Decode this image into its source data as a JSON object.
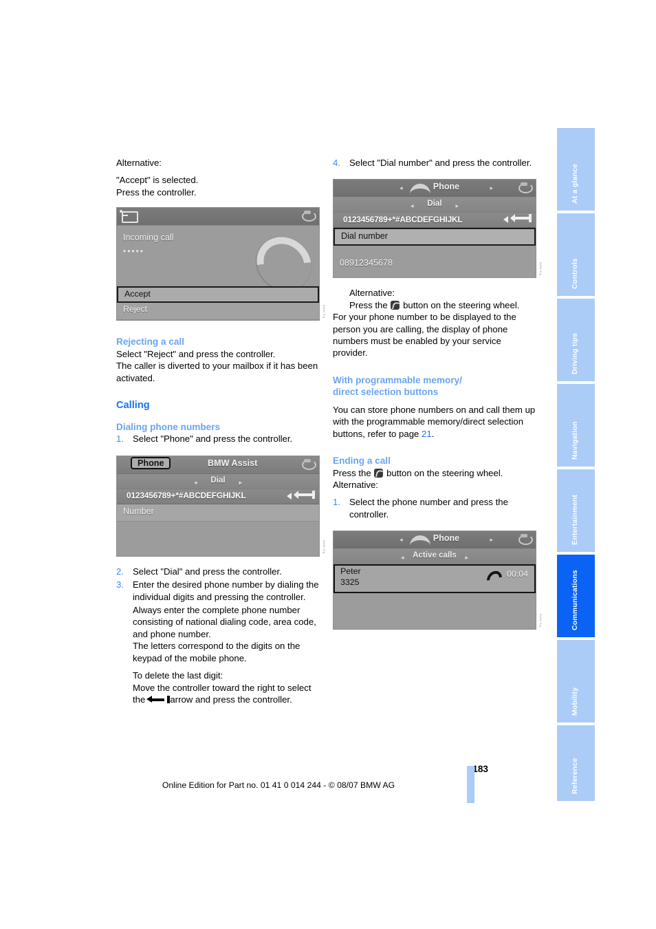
{
  "page": {
    "number": "183",
    "imprint": "Online Edition for Part no. 01 41 0 014 244 - © 08/07 BMW AG"
  },
  "sidebar": {
    "tabs": [
      {
        "label": "At a glance",
        "active": false
      },
      {
        "label": "Controls",
        "active": false
      },
      {
        "label": "Driving tips",
        "active": false
      },
      {
        "label": "Navigation",
        "active": false
      },
      {
        "label": "Entertainment",
        "active": false
      },
      {
        "label": "Communications",
        "active": true
      },
      {
        "label": "Mobility",
        "active": false
      },
      {
        "label": "Reference",
        "active": false
      }
    ],
    "active_color": "#0b63f6",
    "inactive_color": "#aaccf7"
  },
  "left_column": {
    "alt_label": "Alternative:",
    "accept_selected": "\"Accept\" is selected.",
    "press_controller": "Press the controller.",
    "shot_incoming": {
      "header_text": "Incoming call",
      "dots": "•••••",
      "accept": "Accept",
      "reject": "Reject"
    },
    "heading_rejecting": "Rejecting a call",
    "reject_body_1": "Select \"Reject\" and press the controller.",
    "reject_body_2": "The caller is diverted to your mailbox if it has been activated.",
    "heading_calling": "Calling",
    "heading_dialing": "Dialing phone numbers",
    "step1_num": "1.",
    "step1_text": "Select \"Phone\" and press the controller.",
    "shot_dial": {
      "tab_phone": "Phone",
      "tab_bmw_assist": "BMW Assist",
      "subtitle": "Dial",
      "charset": "0123456789+*#ABCDEFGHIJKL",
      "field_label": "Number"
    },
    "step2_num": "2.",
    "step2_text": "Select \"Dial\" and press the controller.",
    "step3_num": "3.",
    "step3_text": "Enter the desired phone number by dialing the individual digits and pressing the controller.",
    "step3_text_b": "Always enter the complete phone number consisting of national dialing code, area code, and phone number.",
    "step3_text_c": "The letters correspond to the digits on the keypad of the mobile phone.",
    "delete_title": "To delete the last digit:",
    "delete_body_pre": "Move the controller toward the right to select the",
    "delete_body_post": "arrow and press the controller."
  },
  "right_column": {
    "step4_num": "4.",
    "step4_text": "Select \"Dial number\" and press the controller.",
    "shot_dialnumber": {
      "title": "Phone",
      "subtitle": "Dial",
      "charset": "0123456789+*#ABCDEFGHIJKL",
      "selected_field": "Dial number",
      "number": "08912345678"
    },
    "alt_label": "Alternative:",
    "alt_press_pre": "Press the",
    "alt_press_post": "button on the steering wheel.",
    "display_note": "For your phone number to be displayed to the person you are calling, the display of phone numbers must be enabled by your service provider.",
    "heading_memory_line1": "With programmable memory/",
    "heading_memory_line2": "direct selection buttons",
    "memory_body_pre": "You can store phone numbers on and call them up with the programmable memory/direct selection buttons, refer to page",
    "memory_page_ref": "21",
    "memory_body_post": ".",
    "heading_ending": "Ending a call",
    "ending_press_pre": "Press the",
    "ending_press_post": "button on the steering wheel.",
    "ending_alt_label": "Alternative:",
    "ending_step1_num": "1.",
    "ending_step1_text": "Select the phone number and press the controller.",
    "shot_activecalls": {
      "title": "Phone",
      "subtitle": "Active calls",
      "name": "Peter",
      "number": "3325",
      "duration": "00:04"
    }
  },
  "icons": {
    "steering_wheel_phone": "phone-button-icon",
    "delete_arrow": "left-arrow-icon",
    "rotary": "rotary-controller-icon",
    "handset": "handset-icon"
  }
}
